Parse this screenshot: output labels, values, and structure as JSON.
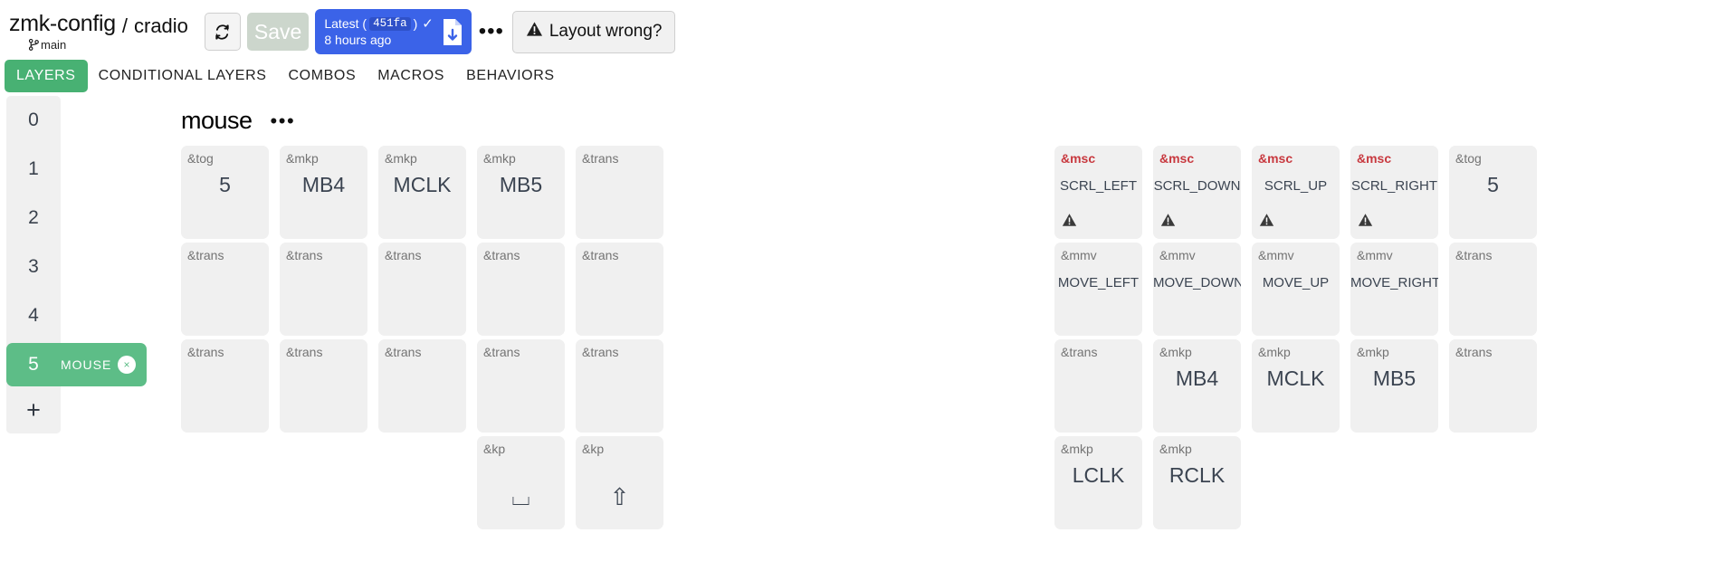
{
  "header": {
    "repo": "zmk-config",
    "branch": "main",
    "separator": "/",
    "keyboard": "cradio",
    "refresh_label": "refresh-icon",
    "save_label": "Save",
    "latest_label": "Latest (",
    "latest_hash": "451fa",
    "latest_paren": ")",
    "latest_check": "✓",
    "latest_time": "8 hours ago",
    "download_icon": "download-file-icon",
    "more_label": "•••",
    "layout_wrong_label": "Layout wrong?",
    "layout_wrong_icon": "⚠"
  },
  "tabs": [
    {
      "label": "LAYERS",
      "active": true
    },
    {
      "label": "CONDITIONAL LAYERS",
      "active": false
    },
    {
      "label": "COMBOS",
      "active": false
    },
    {
      "label": "MACROS",
      "active": false
    },
    {
      "label": "BEHAVIORS",
      "active": false
    }
  ],
  "layers": {
    "items": [
      {
        "num": "0",
        "name": "",
        "selected": false
      },
      {
        "num": "1",
        "name": "",
        "selected": false
      },
      {
        "num": "2",
        "name": "",
        "selected": false
      },
      {
        "num": "3",
        "name": "",
        "selected": false
      },
      {
        "num": "4",
        "name": "",
        "selected": false
      },
      {
        "num": "5",
        "name": "MOUSE",
        "selected": true
      }
    ],
    "delete_label": "×",
    "add_label": "+"
  },
  "keymap": {
    "title": "mouse",
    "more_label": "•••",
    "keys": [
      {
        "col": 0,
        "row": 0,
        "side": "left",
        "behavior": "&tog",
        "value": "5",
        "size": "normal",
        "error": false,
        "warn": false
      },
      {
        "col": 1,
        "row": 0,
        "side": "left",
        "behavior": "&mkp",
        "value": "MB4",
        "size": "normal",
        "error": false,
        "warn": false
      },
      {
        "col": 2,
        "row": 0,
        "side": "left",
        "behavior": "&mkp",
        "value": "MCLK",
        "size": "normal",
        "error": false,
        "warn": false
      },
      {
        "col": 3,
        "row": 0,
        "side": "left",
        "behavior": "&mkp",
        "value": "MB5",
        "size": "normal",
        "error": false,
        "warn": false
      },
      {
        "col": 4,
        "row": 0,
        "side": "left",
        "behavior": "&trans",
        "value": "",
        "size": "normal",
        "error": false,
        "warn": false
      },
      {
        "col": 0,
        "row": 1,
        "side": "left",
        "behavior": "&trans",
        "value": "",
        "size": "normal",
        "error": false,
        "warn": false
      },
      {
        "col": 1,
        "row": 1,
        "side": "left",
        "behavior": "&trans",
        "value": "",
        "size": "normal",
        "error": false,
        "warn": false
      },
      {
        "col": 2,
        "row": 1,
        "side": "left",
        "behavior": "&trans",
        "value": "",
        "size": "normal",
        "error": false,
        "warn": false
      },
      {
        "col": 3,
        "row": 1,
        "side": "left",
        "behavior": "&trans",
        "value": "",
        "size": "normal",
        "error": false,
        "warn": false
      },
      {
        "col": 4,
        "row": 1,
        "side": "left",
        "behavior": "&trans",
        "value": "",
        "size": "normal",
        "error": false,
        "warn": false
      },
      {
        "col": 0,
        "row": 2,
        "side": "left",
        "behavior": "&trans",
        "value": "",
        "size": "normal",
        "error": false,
        "warn": false
      },
      {
        "col": 1,
        "row": 2,
        "side": "left",
        "behavior": "&trans",
        "value": "",
        "size": "normal",
        "error": false,
        "warn": false
      },
      {
        "col": 2,
        "row": 2,
        "side": "left",
        "behavior": "&trans",
        "value": "",
        "size": "normal",
        "error": false,
        "warn": false
      },
      {
        "col": 3,
        "row": 2,
        "side": "left",
        "behavior": "&trans",
        "value": "",
        "size": "normal",
        "error": false,
        "warn": false
      },
      {
        "col": 4,
        "row": 2,
        "side": "left",
        "behavior": "&trans",
        "value": "",
        "size": "normal",
        "error": false,
        "warn": false
      },
      {
        "col": 3,
        "row": 3,
        "side": "left",
        "behavior": "&kp",
        "value": "⌴",
        "size": "glyph",
        "error": false,
        "warn": false
      },
      {
        "col": 4,
        "row": 3,
        "side": "left",
        "behavior": "&kp",
        "value": "⇧",
        "size": "glyph",
        "error": false,
        "warn": false
      },
      {
        "col": 0,
        "row": 0,
        "side": "right",
        "behavior": "&msc",
        "value": "SCRL_LEFT",
        "size": "small",
        "error": true,
        "warn": true
      },
      {
        "col": 1,
        "row": 0,
        "side": "right",
        "behavior": "&msc",
        "value": "SCRL_DOWN",
        "size": "small",
        "error": true,
        "warn": true
      },
      {
        "col": 2,
        "row": 0,
        "side": "right",
        "behavior": "&msc",
        "value": "SCRL_UP",
        "size": "small",
        "error": true,
        "warn": true
      },
      {
        "col": 3,
        "row": 0,
        "side": "right",
        "behavior": "&msc",
        "value": "SCRL_RIGHT",
        "size": "small",
        "error": true,
        "warn": true
      },
      {
        "col": 4,
        "row": 0,
        "side": "right",
        "behavior": "&tog",
        "value": "5",
        "size": "normal",
        "error": false,
        "warn": false
      },
      {
        "col": 0,
        "row": 1,
        "side": "right",
        "behavior": "&mmv",
        "value": "MOVE_LEFT",
        "size": "small",
        "error": false,
        "warn": false
      },
      {
        "col": 1,
        "row": 1,
        "side": "right",
        "behavior": "&mmv",
        "value": "MOVE_DOWN",
        "size": "small",
        "error": false,
        "warn": false
      },
      {
        "col": 2,
        "row": 1,
        "side": "right",
        "behavior": "&mmv",
        "value": "MOVE_UP",
        "size": "small",
        "error": false,
        "warn": false
      },
      {
        "col": 3,
        "row": 1,
        "side": "right",
        "behavior": "&mmv",
        "value": "MOVE_RIGHT",
        "size": "small",
        "error": false,
        "warn": false
      },
      {
        "col": 4,
        "row": 1,
        "side": "right",
        "behavior": "&trans",
        "value": "",
        "size": "normal",
        "error": false,
        "warn": false
      },
      {
        "col": 0,
        "row": 2,
        "side": "right",
        "behavior": "&trans",
        "value": "",
        "size": "normal",
        "error": false,
        "warn": false
      },
      {
        "col": 1,
        "row": 2,
        "side": "right",
        "behavior": "&mkp",
        "value": "MB4",
        "size": "normal",
        "error": false,
        "warn": false
      },
      {
        "col": 2,
        "row": 2,
        "side": "right",
        "behavior": "&mkp",
        "value": "MCLK",
        "size": "normal",
        "error": false,
        "warn": false
      },
      {
        "col": 3,
        "row": 2,
        "side": "right",
        "behavior": "&mkp",
        "value": "MB5",
        "size": "normal",
        "error": false,
        "warn": false
      },
      {
        "col": 4,
        "row": 2,
        "side": "right",
        "behavior": "&trans",
        "value": "",
        "size": "normal",
        "error": false,
        "warn": false
      },
      {
        "col": 0,
        "row": 3,
        "side": "right",
        "behavior": "&mkp",
        "value": "LCLK",
        "size": "normal",
        "error": false,
        "warn": false
      },
      {
        "col": 1,
        "row": 3,
        "side": "right",
        "behavior": "&mkp",
        "value": "RCLK",
        "size": "normal",
        "error": false,
        "warn": false
      }
    ],
    "warn_glyph": "⚠"
  },
  "colors": {
    "accent_green": "#48b173",
    "layer_green": "#5dbd87",
    "commit_blue": "#3b63e8",
    "error_red": "#c8393f",
    "key_bg": "#f0f0f0"
  }
}
